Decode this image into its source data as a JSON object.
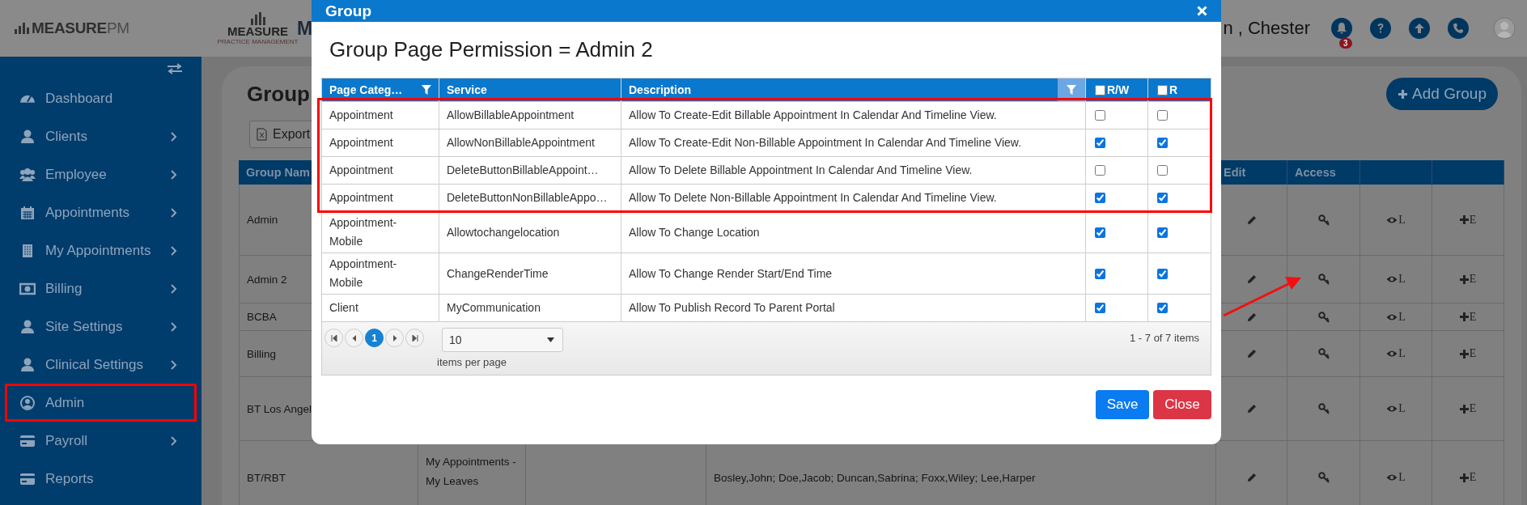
{
  "header": {
    "logo_word": "MEASURE",
    "logo_suffix": "PM",
    "brand_word": "MEASURE",
    "brand_tagline": "PRACTICE MANAGEMENT",
    "title_fragment": "M",
    "user_fragment": "n , Chester",
    "notification_count": "3"
  },
  "sidebar": {
    "items": [
      {
        "label": "Dashboard",
        "has_submenu": false,
        "outlined": false
      },
      {
        "label": "Clients",
        "has_submenu": true,
        "outlined": false
      },
      {
        "label": "Employee",
        "has_submenu": true,
        "outlined": false
      },
      {
        "label": "Appointments",
        "has_submenu": true,
        "outlined": false
      },
      {
        "label": "My Appointments",
        "has_submenu": true,
        "outlined": false
      },
      {
        "label": "Billing",
        "has_submenu": true,
        "outlined": false
      },
      {
        "label": "Site Settings",
        "has_submenu": true,
        "outlined": false
      },
      {
        "label": "Clinical Settings",
        "has_submenu": true,
        "outlined": false
      },
      {
        "label": "Admin",
        "has_submenu": false,
        "outlined": true
      },
      {
        "label": "Payroll",
        "has_submenu": true,
        "outlined": false
      },
      {
        "label": "Reports",
        "has_submenu": false,
        "outlined": false
      }
    ]
  },
  "page": {
    "title": "Group",
    "export_button": "Export",
    "add_button": "Add Group",
    "table": {
      "columns": {
        "group_name": "Group Nam",
        "edit": "Edit",
        "access": "Access"
      },
      "rows": [
        {
          "name": "Admin",
          "view_label": "L",
          "add_label": "E"
        },
        {
          "name": "Admin 2",
          "view_label": "L",
          "add_label": "E"
        },
        {
          "name": "BCBA",
          "view_label": "L",
          "add_label": "E"
        },
        {
          "name": "Billing",
          "view_label": "L",
          "add_label": "E"
        },
        {
          "name": "BT Los Angel",
          "view_label": "L",
          "add_label": "E"
        },
        {
          "name": "BT/RBT",
          "pages": "My Appointments - My Leaves",
          "members": "Bosley,John; Doe,Jacob; Duncan,Sabrina; Foxx,Wiley; Lee,Harper",
          "view_label": "L",
          "add_label": "E"
        }
      ]
    }
  },
  "dialog": {
    "title": "Group",
    "heading": "Group Page Permission = Admin 2",
    "columns": {
      "category": "Page Categ…",
      "service": "Service",
      "description": "Description",
      "read_write": "R/W",
      "read_write_all": false,
      "read": "R",
      "read_all": false
    },
    "rows": [
      {
        "category": "Appointment",
        "service": "AllowBillableAppointment",
        "description": "Allow To Create-Edit Billable Appointment In Calendar And Timeline View.",
        "read_write": false,
        "read": false
      },
      {
        "category": "Appointment",
        "service": "AllowNonBillableAppointment",
        "description": "Allow To Create-Edit Non-Billable Appointment In Calendar And Timeline View.",
        "read_write": true,
        "read": true
      },
      {
        "category": "Appointment",
        "service": "DeleteButtonBillableAppoint…",
        "description": "Allow To Delete Billable Appointment In Calendar And Timeline View.",
        "read_write": false,
        "read": false
      },
      {
        "category": "Appointment",
        "service": "DeleteButtonNonBillableAppo…",
        "description": "Allow To Delete Non-Billable Appointment In Calendar And Timeline View.",
        "read_write": true,
        "read": true
      },
      {
        "category": "Appointment-Mobile",
        "service": "Allowtochangelocation",
        "description": "Allow To Change Location",
        "read_write": true,
        "read": true
      },
      {
        "category": "Appointment-Mobile",
        "service": "ChangeRenderTime",
        "description": "Allow To Change Render Start/End Time",
        "read_write": true,
        "read": true
      },
      {
        "category": "Client",
        "service": "MyCommunication",
        "description": "Allow To Publish Record To Parent Portal",
        "read_write": true,
        "read": true
      }
    ],
    "pager": {
      "pages": [
        {
          "label": "1",
          "selected": true
        }
      ],
      "page_size": "10",
      "page_size_label": "items per page",
      "summary": "1 - 7 of 7 items"
    },
    "buttons": {
      "save": "Save",
      "close": "Close"
    }
  }
}
